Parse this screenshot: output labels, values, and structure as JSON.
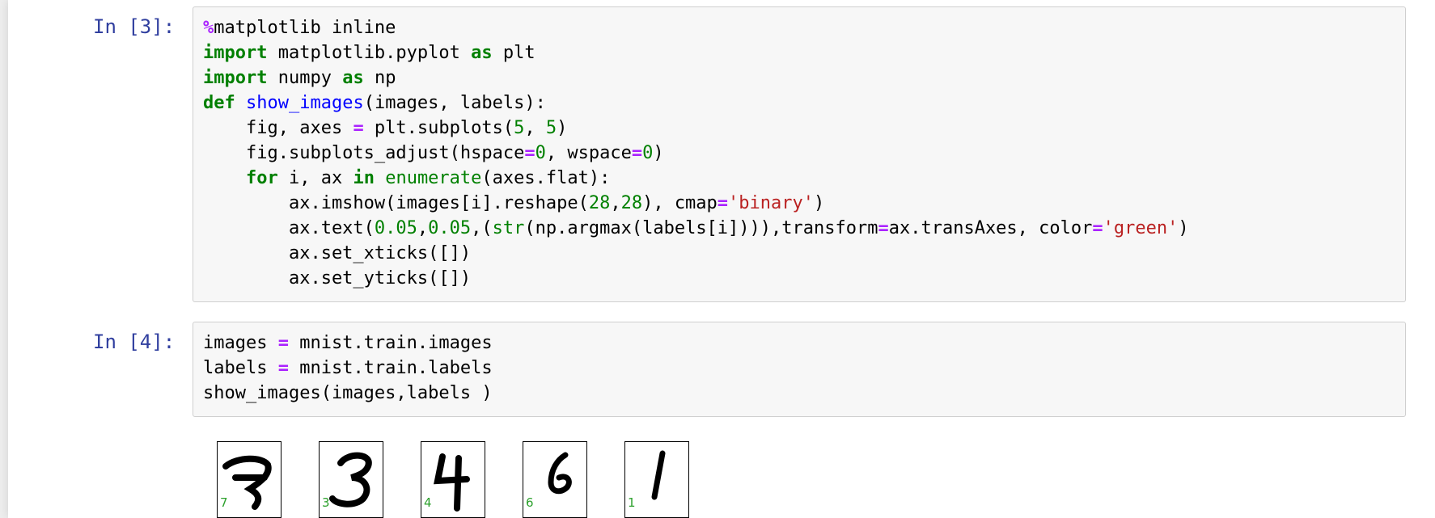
{
  "cells": [
    {
      "prompt": "In [3]:",
      "code_lines": [
        [
          [
            "op",
            "%"
          ],
          [
            "plain",
            "matplotlib inline"
          ]
        ],
        [
          [
            "kw",
            "import"
          ],
          [
            "plain",
            " matplotlib.pyplot "
          ],
          [
            "kw",
            "as"
          ],
          [
            "plain",
            " plt"
          ]
        ],
        [
          [
            "kw",
            "import"
          ],
          [
            "plain",
            " numpy "
          ],
          [
            "kw",
            "as"
          ],
          [
            "plain",
            " np"
          ]
        ],
        [
          [
            "kw",
            "def"
          ],
          [
            "plain",
            " "
          ],
          [
            "fn",
            "show_images"
          ],
          [
            "plain",
            "(images, labels):"
          ]
        ],
        [
          [
            "plain",
            "    fig, axes "
          ],
          [
            "op",
            "="
          ],
          [
            "plain",
            " plt.subplots("
          ],
          [
            "num",
            "5"
          ],
          [
            "plain",
            ", "
          ],
          [
            "num",
            "5"
          ],
          [
            "plain",
            ")"
          ]
        ],
        [
          [
            "plain",
            "    fig.subplots_adjust(hspace"
          ],
          [
            "op",
            "="
          ],
          [
            "num",
            "0"
          ],
          [
            "plain",
            ", wspace"
          ],
          [
            "op",
            "="
          ],
          [
            "num",
            "0"
          ],
          [
            "plain",
            ")"
          ]
        ],
        [
          [
            "plain",
            "    "
          ],
          [
            "kw",
            "for"
          ],
          [
            "plain",
            " i, ax "
          ],
          [
            "kw",
            "in"
          ],
          [
            "plain",
            " "
          ],
          [
            "bi",
            "enumerate"
          ],
          [
            "plain",
            "(axes.flat):"
          ]
        ],
        [
          [
            "plain",
            "        ax.imshow(images[i].reshape("
          ],
          [
            "num",
            "28"
          ],
          [
            "plain",
            ","
          ],
          [
            "num",
            "28"
          ],
          [
            "plain",
            "), cmap"
          ],
          [
            "op",
            "="
          ],
          [
            "str",
            "'binary'"
          ],
          [
            "plain",
            ")"
          ]
        ],
        [
          [
            "plain",
            "        ax.text("
          ],
          [
            "num",
            "0.05"
          ],
          [
            "plain",
            ","
          ],
          [
            "num",
            "0.05"
          ],
          [
            "plain",
            ",("
          ],
          [
            "bi",
            "str"
          ],
          [
            "plain",
            "(np.argmax(labels[i]))),transform"
          ],
          [
            "op",
            "="
          ],
          [
            "plain",
            "ax.transAxes, color"
          ],
          [
            "op",
            "="
          ],
          [
            "str",
            "'green'"
          ],
          [
            "plain",
            ")"
          ]
        ],
        [
          [
            "plain",
            "        ax.set_xticks([])"
          ]
        ],
        [
          [
            "plain",
            "        ax.set_yticks([])"
          ]
        ]
      ]
    },
    {
      "prompt": "In [4]:",
      "code_lines": [
        [
          [
            "plain",
            "images "
          ],
          [
            "op",
            "="
          ],
          [
            "plain",
            " mnist.train.images"
          ]
        ],
        [
          [
            "plain",
            "labels "
          ],
          [
            "op",
            "="
          ],
          [
            "plain",
            " mnist.train.labels"
          ]
        ],
        [
          [
            "plain",
            "show_images(images,labels )"
          ]
        ]
      ]
    }
  ],
  "output": {
    "digit_labels": [
      "7",
      "3",
      "4",
      "6",
      "1"
    ],
    "label_color": "#2ca02c"
  },
  "colors": {
    "prompt": "#303F9F",
    "keyword": "#008000",
    "operator": "#AA22FF",
    "string": "#BA2121",
    "function": "#0000FF"
  }
}
